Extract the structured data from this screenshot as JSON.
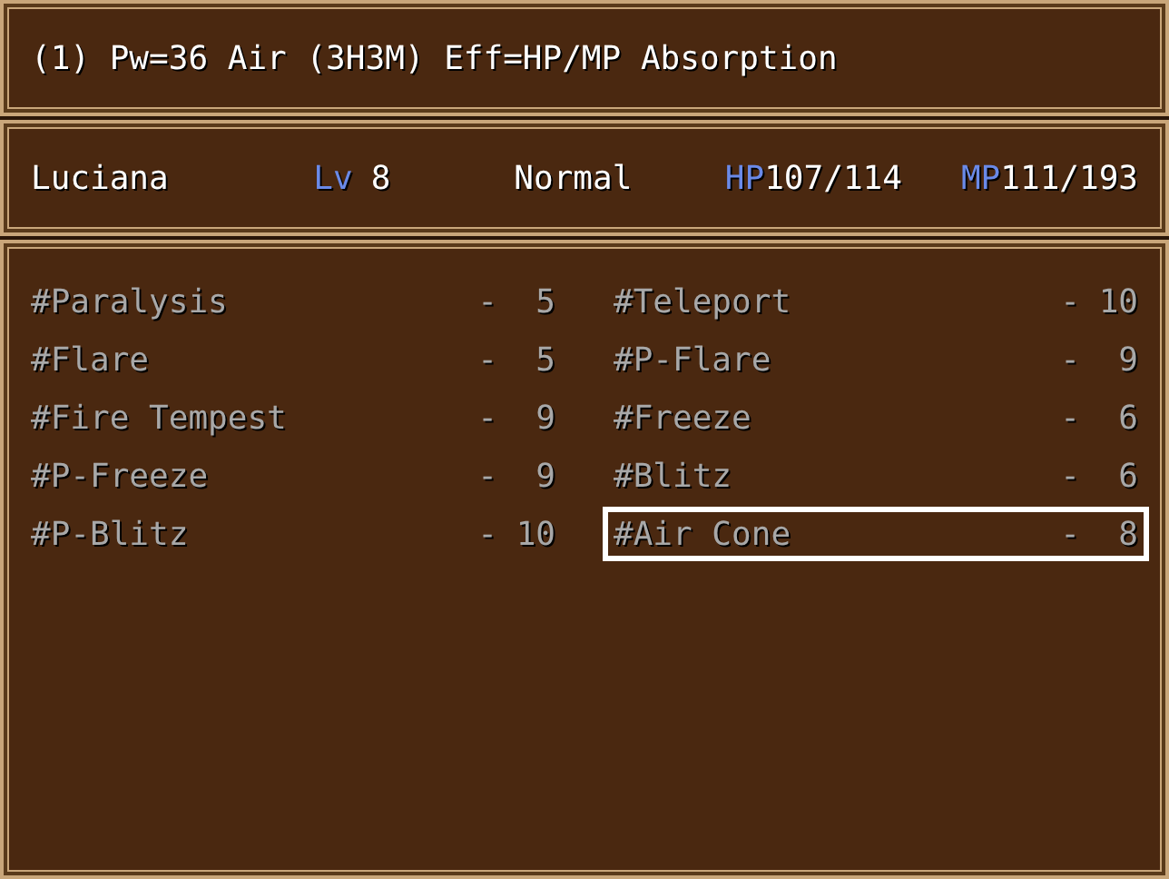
{
  "help": {
    "text": "(1) Pw=36 Air (3H3M) Eff=HP/MP Absorption"
  },
  "status": {
    "name": "Luciana",
    "level_label": "Lv",
    "level": "8",
    "condition": "Normal",
    "hp_label": "HP",
    "hp": "107/114",
    "mp_label": "MP",
    "mp": "111/193"
  },
  "skills": [
    {
      "name": "#Paralysis",
      "dash": "-",
      "cost": "5",
      "disabled": true,
      "selected": false
    },
    {
      "name": "#Teleport",
      "dash": "-",
      "cost": "10",
      "disabled": true,
      "selected": false
    },
    {
      "name": "#Flare",
      "dash": "-",
      "cost": "5",
      "disabled": true,
      "selected": false
    },
    {
      "name": "#P-Flare",
      "dash": "-",
      "cost": "9",
      "disabled": true,
      "selected": false
    },
    {
      "name": "#Fire Tempest",
      "dash": "-",
      "cost": "9",
      "disabled": true,
      "selected": false
    },
    {
      "name": "#Freeze",
      "dash": "-",
      "cost": "6",
      "disabled": true,
      "selected": false
    },
    {
      "name": "#P-Freeze",
      "dash": "-",
      "cost": "9",
      "disabled": true,
      "selected": false
    },
    {
      "name": "#Blitz",
      "dash": "-",
      "cost": "6",
      "disabled": true,
      "selected": false
    },
    {
      "name": "#P-Blitz",
      "dash": "-",
      "cost": "10",
      "disabled": true,
      "selected": false
    },
    {
      "name": "#Air Cone",
      "dash": "-",
      "cost": "8",
      "disabled": true,
      "selected": true
    }
  ]
}
